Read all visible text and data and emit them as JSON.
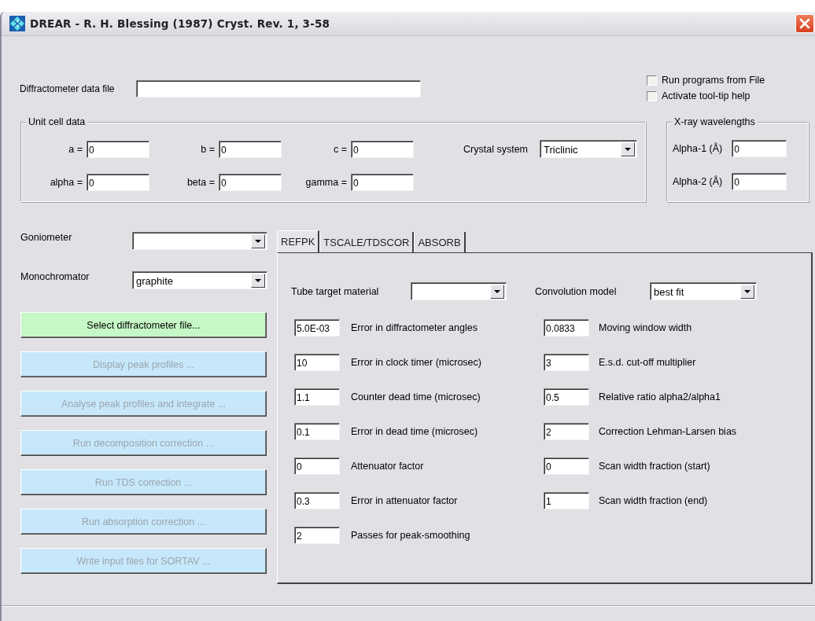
{
  "window": {
    "title": "DREAR  - R. H. Blessing (1987) Cryst. Rev. 1, 3-58"
  },
  "data_file": {
    "label": "Diffractometer data file"
  },
  "options": [
    {
      "label": "Run programs from File",
      "checked": false
    },
    {
      "label": "Activate tool-tip help",
      "checked": false
    }
  ],
  "unit_cell": {
    "title": "Unit cell data",
    "fields": [
      {
        "label": "a =",
        "value": "0"
      },
      {
        "label": "b =",
        "value": "0"
      },
      {
        "label": "c =",
        "value": "0"
      },
      {
        "label": "alpha =",
        "value": "0"
      },
      {
        "label": "beta =",
        "value": "0"
      },
      {
        "label": "gamma =",
        "value": "0"
      }
    ],
    "crystal_system": {
      "label": "Crystal system",
      "value": "Triclinic"
    }
  },
  "xray": {
    "title": "X-ray wavelengths",
    "fields": [
      {
        "label": "Alpha-1 (Å)",
        "value": "0"
      },
      {
        "label": "Alpha-2 (Å)",
        "value": "0"
      }
    ]
  },
  "goniometer": {
    "label": "Goniometer"
  },
  "monochromator": {
    "label": "Monochromator",
    "value": "graphite"
  },
  "actions": [
    {
      "label": "Select diffractometer file...",
      "disabled": false
    },
    {
      "label": "Display peak profiles ...",
      "disabled": true
    },
    {
      "label": "Analyse peak profiles and integrate ...",
      "disabled": true
    },
    {
      "label": "Run decomposition correction ...",
      "disabled": true
    },
    {
      "label": "Run TDS correction ...",
      "disabled": true
    },
    {
      "label": "Run absorption correction ...",
      "disabled": true
    },
    {
      "label": "Write input files for SORTAV ...",
      "disabled": true
    }
  ],
  "tabs": [
    {
      "label": "REFPK",
      "selected": true
    },
    {
      "label": "TSCALE/TDSCOR",
      "selected": false
    },
    {
      "label": "ABSORB",
      "selected": false
    }
  ],
  "refpk": {
    "tube_target": {
      "label": "Tube target material"
    },
    "convolution": {
      "label": "Convolution model",
      "value": "best fit"
    },
    "left": [
      {
        "value": "5.0E-03",
        "label": "Error in diffractometer angles"
      },
      {
        "value": "10",
        "label": "Error in clock timer (microsec)"
      },
      {
        "value": "1.1",
        "label": "Counter dead time (microsec)"
      },
      {
        "value": "0.1",
        "label": "Error in dead time (microsec)"
      },
      {
        "value": "0",
        "label": "Attenuator factor"
      },
      {
        "value": "0.3",
        "label": "Error in  attenuator factor"
      },
      {
        "value": "2",
        "label": "Passes for peak-smoothing"
      }
    ],
    "right": [
      {
        "value": "0.0833",
        "label": "Moving window width"
      },
      {
        "value": "3",
        "label": "E.s.d. cut-off multiplier"
      },
      {
        "value": "0.5",
        "label": "Relative ratio alpha2/alpha1"
      },
      {
        "value": "2",
        "label": "Correction Lehman-Larsen bias"
      },
      {
        "value": "0",
        "label": "Scan width fraction (start)"
      },
      {
        "value": "1",
        "label": "Scan width fraction (end)"
      }
    ]
  }
}
